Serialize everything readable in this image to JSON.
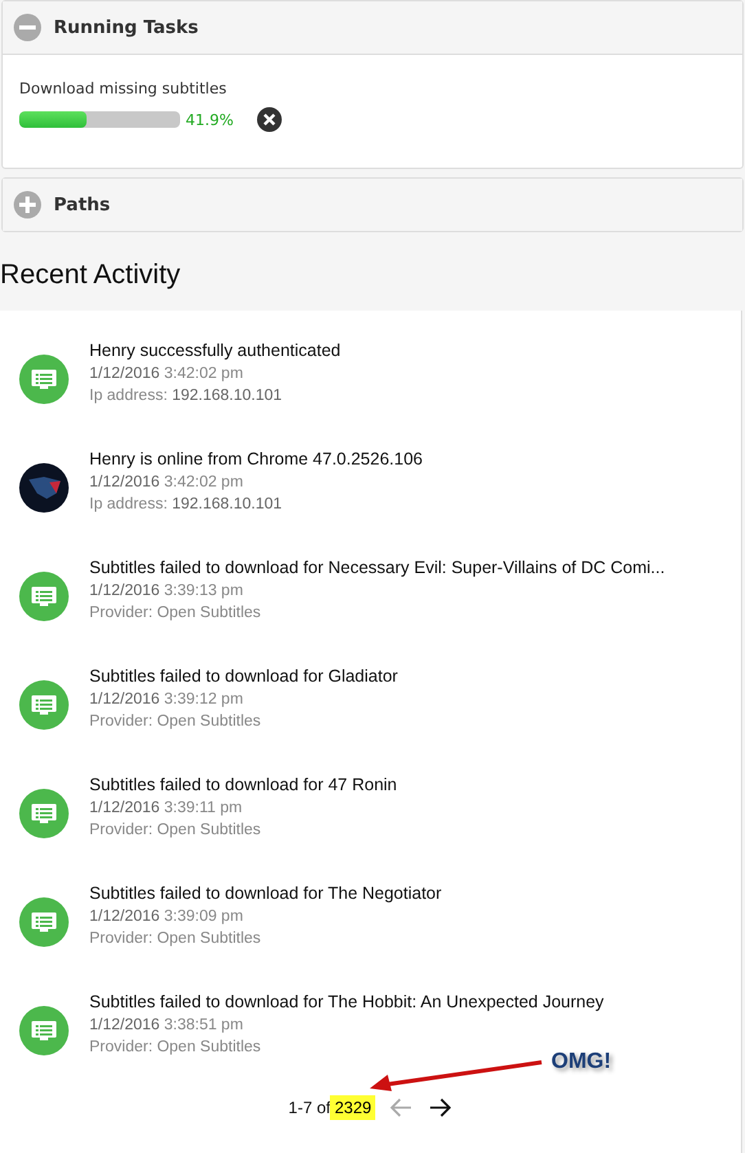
{
  "panels": [
    {
      "title": "Running Tasks",
      "expanded": true,
      "tasks": [
        {
          "name": "Download missing subtitles",
          "level": 0.419,
          "reading": "41.9%"
        }
      ]
    },
    {
      "title": "Paths",
      "expanded": false
    }
  ],
  "recent_activity": {
    "heading": "Recent Activity",
    "items": [
      {
        "kind": "event",
        "title": "Henry successfully authenticated",
        "date": "**1/12/2016** 3:42:02 pm",
        "detail": "Ip address: **192.168.10.101**"
      },
      {
        "kind": "avatar",
        "title": "Henry is online from Chrome 47.0.2526.106",
        "date": "**1/12/2016** 3:42:02 pm",
        "detail": "Ip address: **192.168.10.101**"
      },
      {
        "kind": "event",
        "title": "Subtitles failed to download for Necessary Evil: Super-Villains of DC Comi...",
        "date": "**1/12/2016** 3:39:13 pm",
        "detail": "Provider: Open Subtitles"
      },
      {
        "kind": "event",
        "title": "Subtitles failed to download for Gladiator",
        "date": "**1/12/2016** 3:39:12 pm",
        "detail": "Provider: Open Subtitles"
      },
      {
        "kind": "event",
        "title": "Subtitles failed to download for 47 Ronin",
        "date": "**1/12/2016** 3:39:11 pm",
        "detail": "Provider: Open Subtitles"
      },
      {
        "kind": "event",
        "title": "Subtitles failed to download for The Negotiator",
        "date": "**1/12/2016** 3:39:09 pm",
        "detail": "Provider: Open Subtitles"
      },
      {
        "kind": "event",
        "title": "Subtitles failed to download for The Hobbit: An Unexpected Journey",
        "date": "**1/12/2016** 3:38:51 pm",
        "detail": "Provider: Open Subtitles"
      }
    ],
    "pagination": {
      "range": "1-7 of",
      "total": "2329",
      "total_highlighted": true,
      "prev_disabled": true,
      "next_disabled": false
    }
  },
  "annotation": {
    "text": "OMG!"
  }
}
